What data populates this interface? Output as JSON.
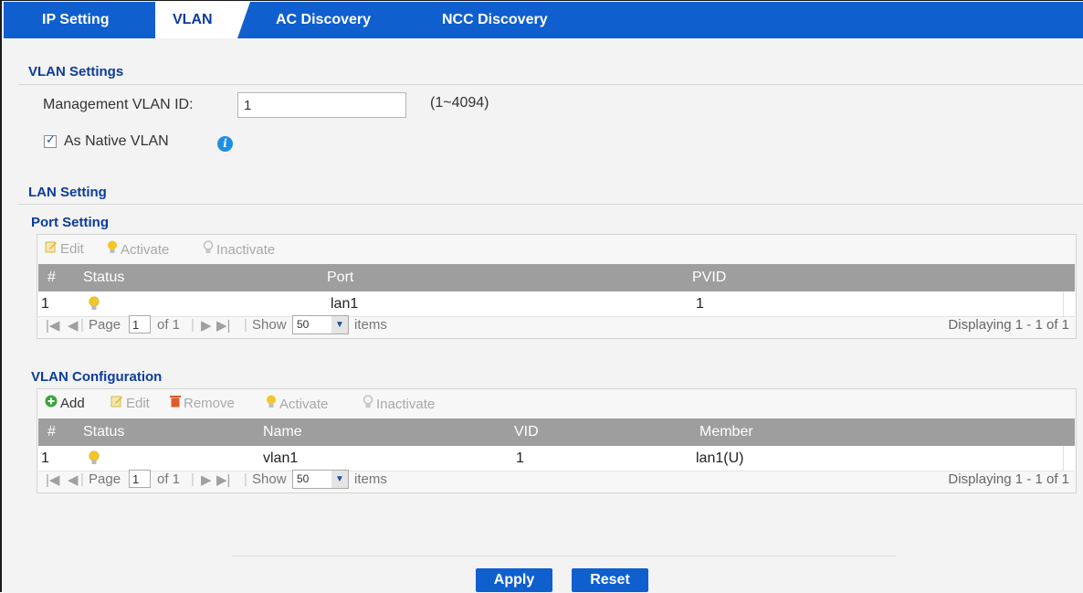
{
  "tabs": [
    {
      "label": "IP Setting"
    },
    {
      "label": "VLAN"
    },
    {
      "label": "AC Discovery"
    },
    {
      "label": "NCC Discovery"
    }
  ],
  "vlan_settings": {
    "title": "VLAN Settings",
    "mgmt_label": "Management VLAN ID:",
    "mgmt_value": "1",
    "range_hint": "(1~4094)",
    "native_label": "As Native VLAN",
    "native_checked": true
  },
  "lan_setting": {
    "title": "LAN Setting"
  },
  "port_setting": {
    "title": "Port Setting",
    "toolbar": {
      "edit": "Edit",
      "activate": "Activate",
      "inactivate": "Inactivate"
    },
    "columns": {
      "num": "#",
      "status": "Status",
      "port": "Port",
      "pvid": "PVID"
    },
    "rows": [
      {
        "num": "1",
        "status": "active",
        "port": "lan1",
        "pvid": "1"
      }
    ],
    "pager": {
      "page_label": "Page",
      "page_value": "1",
      "of_label": "of 1",
      "show_label": "Show",
      "show_value": "50",
      "items_label": "items",
      "display": "Displaying 1 - 1 of 1"
    }
  },
  "vlan_config": {
    "title": "VLAN Configuration",
    "toolbar": {
      "add": "Add",
      "edit": "Edit",
      "remove": "Remove",
      "activate": "Activate",
      "inactivate": "Inactivate"
    },
    "columns": {
      "num": "#",
      "status": "Status",
      "name": "Name",
      "vid": "VID",
      "member": "Member"
    },
    "rows": [
      {
        "num": "1",
        "status": "active",
        "name": "vlan1",
        "vid": "1",
        "member": "lan1(U)"
      }
    ],
    "pager": {
      "page_label": "Page",
      "page_value": "1",
      "of_label": "of 1",
      "show_label": "Show",
      "show_value": "50",
      "items_label": "items",
      "display": "Displaying 1 - 1 of 1"
    }
  },
  "buttons": {
    "apply": "Apply",
    "reset": "Reset"
  },
  "colors": {
    "tab_bar": "#0f5fcf",
    "title": "#0c3c9c",
    "grid_header": "#9e9e9e",
    "bulb": "#f2c72a",
    "add_icon": "#3aa43a",
    "remove_icon": "#e05a2a"
  }
}
